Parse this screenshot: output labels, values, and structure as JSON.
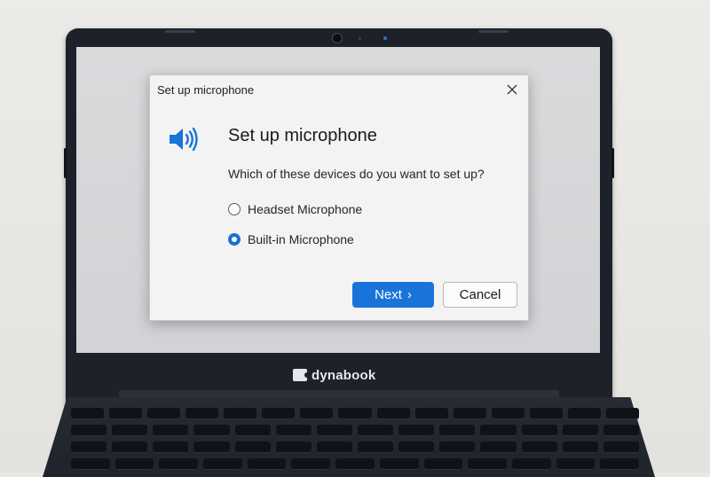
{
  "dialog": {
    "title": "Set up microphone",
    "close_icon": "close-icon",
    "speaker_icon": "speaker-icon",
    "heading": "Set up microphone",
    "question": "Which of these devices do you want to set up?",
    "options": [
      {
        "label": "Headset Microphone",
        "selected": false
      },
      {
        "label": "Built-in Microphone",
        "selected": true
      }
    ],
    "next_label": "Next",
    "next_chevron": "›",
    "cancel_label": "Cancel"
  },
  "laptop": {
    "brand": "dynabook"
  },
  "colors": {
    "accent": "#1a73d9",
    "dialog_bg": "#f3f3f3",
    "bezel": "#1d2129"
  }
}
